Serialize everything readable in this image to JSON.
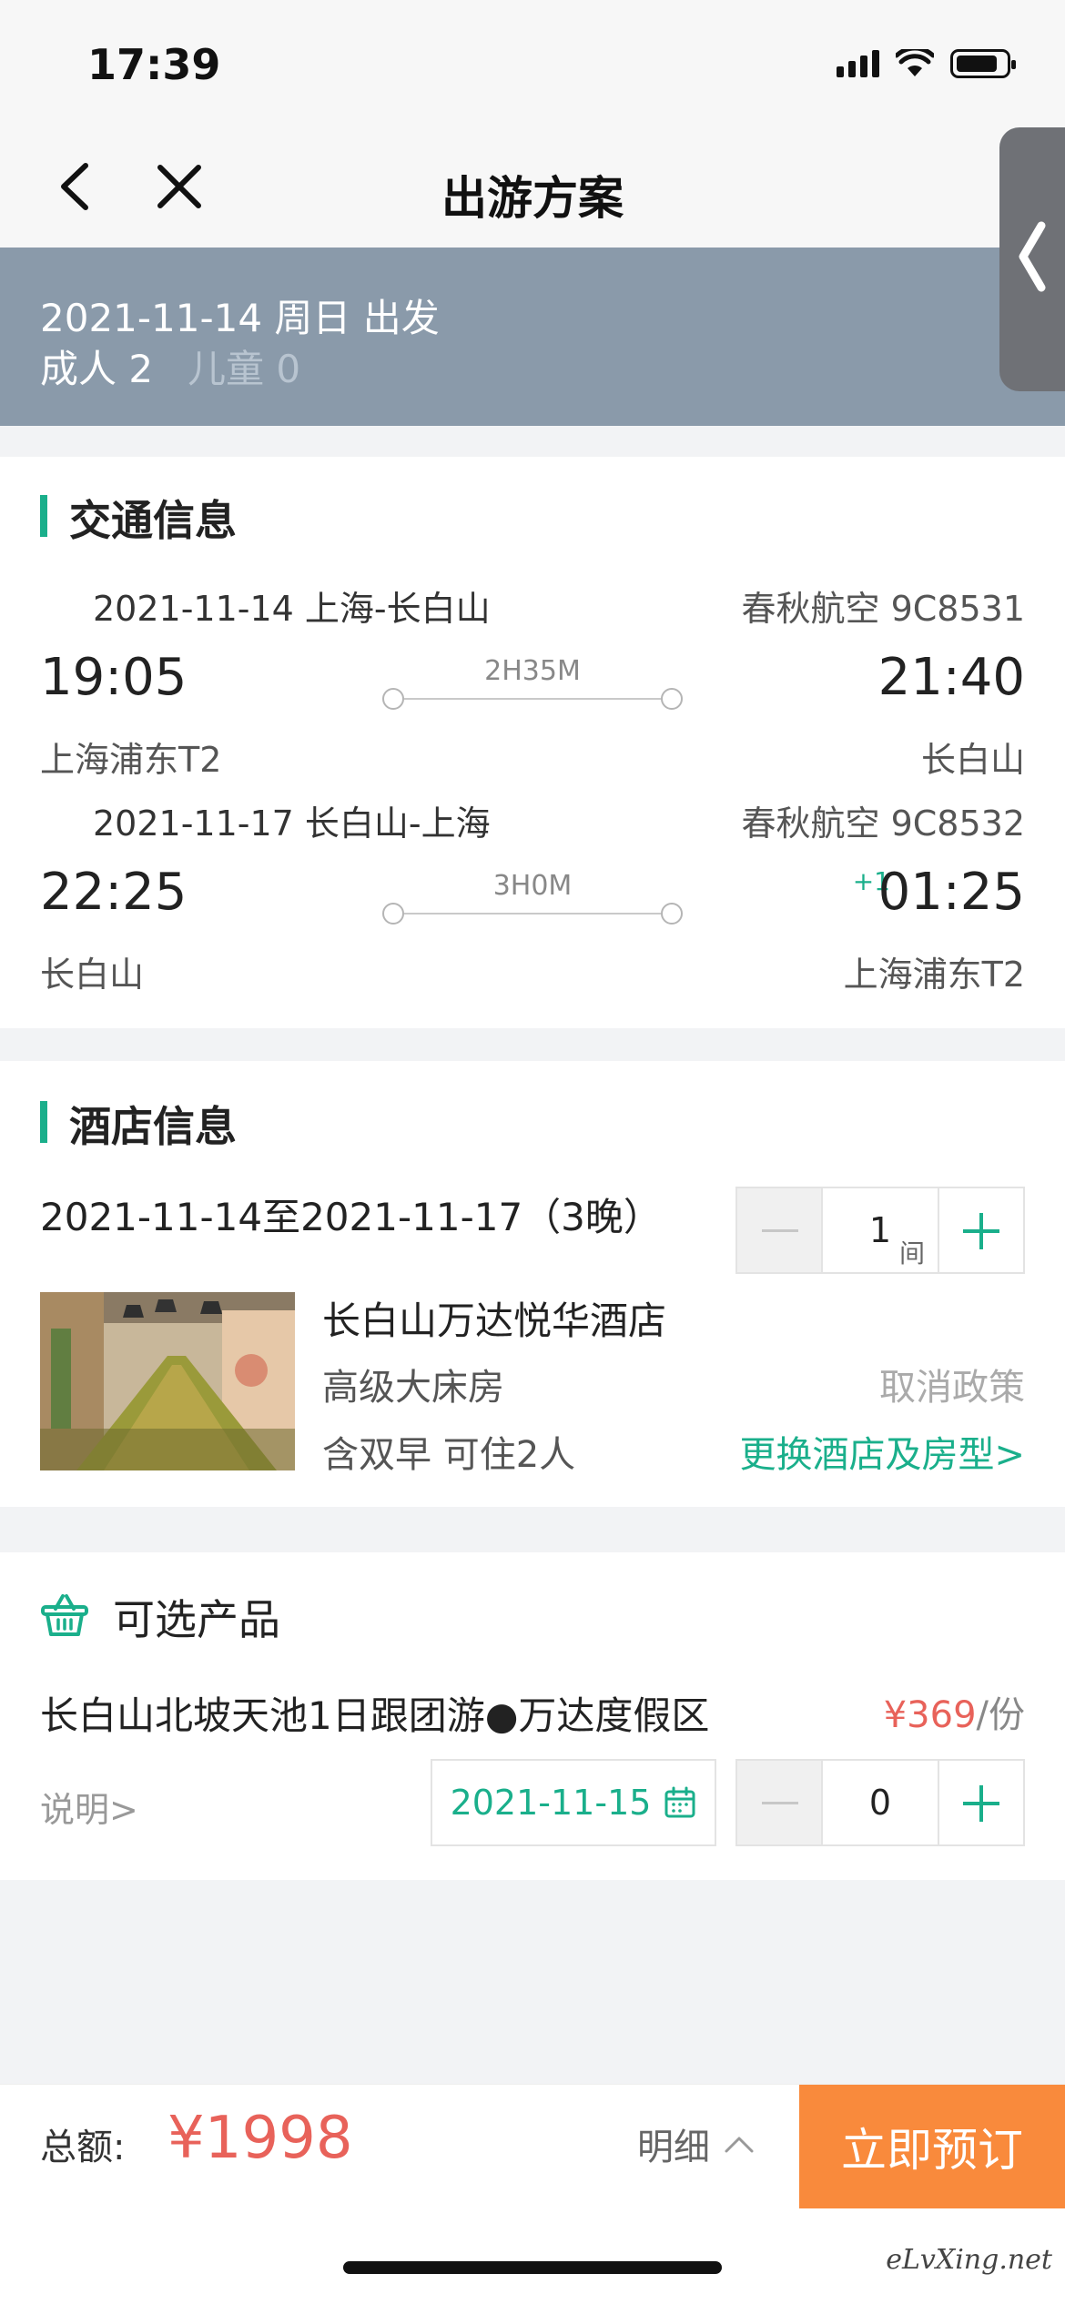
{
  "status_bar": {
    "time": "17:39"
  },
  "nav": {
    "title": "出游方案"
  },
  "trip": {
    "departure": "2021-11-14 周日 出发",
    "adults": "成人 2",
    "children": "儿童 0"
  },
  "transport": {
    "title": "交通信息",
    "flights": [
      {
        "date_route": "2021-11-14 上海-长白山",
        "airline_flight": "春秋航空 9C8531",
        "dep_time": "19:05",
        "arr_time": "21:40",
        "duration": "2H35M",
        "dep_airport": "上海浦东T2",
        "arr_airport": "长白山",
        "plus_day": ""
      },
      {
        "date_route": "2021-11-17 长白山-上海",
        "airline_flight": "春秋航空 9C8532",
        "dep_time": "22:25",
        "arr_time": "01:25",
        "duration": "3H0M",
        "dep_airport": "长白山",
        "arr_airport": "上海浦东T2",
        "plus_day": "+1"
      }
    ]
  },
  "hotel": {
    "title": "酒店信息",
    "dates": "2021-11-14至2021-11-17（3晚）",
    "rooms": "1",
    "room_unit": "间",
    "name": "长白山万达悦华酒店",
    "room_type": "高级大床房",
    "cancel_policy": "取消政策",
    "meal": "含双早  可住2人",
    "change_link": "更换酒店及房型>"
  },
  "optional": {
    "title": "可选产品",
    "product_name": "长白山北坡天池1日跟团游●万达度假区",
    "price": "¥369",
    "price_unit": "/份",
    "explain": "说明>",
    "date": "2021-11-15",
    "quantity": "0"
  },
  "footer": {
    "total_label": "总额:",
    "total_amount": "¥1998",
    "detail": "明细",
    "book": "立即预订"
  },
  "watermark": "eLvXing.net",
  "colors": {
    "accent": "#1aaf8b",
    "price": "#e8625a",
    "book_button": "#f98a3c",
    "banner": "#8a9aaa"
  },
  "icons": [
    "back-arrow-icon",
    "close-icon",
    "side-tab-chevron-icon",
    "basket-icon",
    "calendar-icon",
    "chevron-up-icon",
    "signal-icon",
    "wifi-icon",
    "battery-icon"
  ]
}
